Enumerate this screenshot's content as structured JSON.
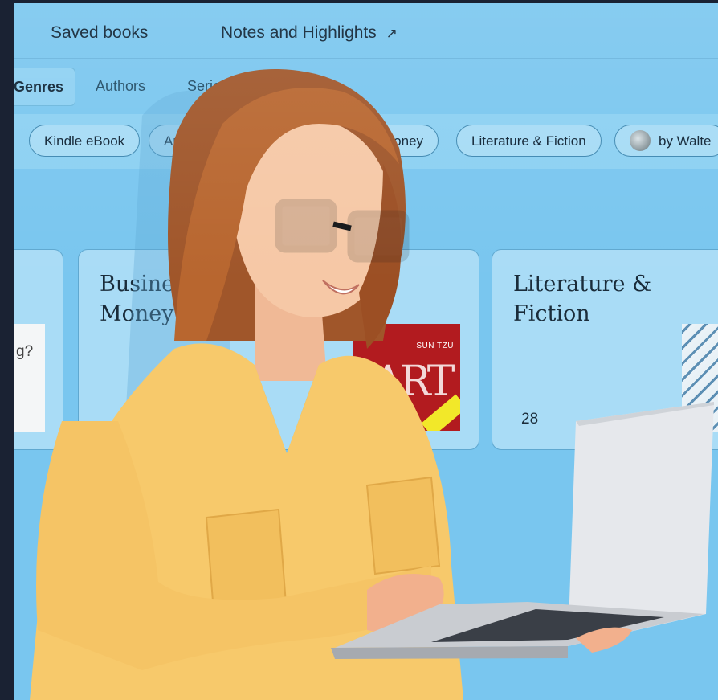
{
  "nav": {
    "saved_books": "Saved books",
    "notes_highlights": "Notes and Highlights",
    "external_icon": "arrow-up-right-icon"
  },
  "tabs": [
    {
      "label": "Genres",
      "active": true
    },
    {
      "label": "Authors",
      "active": false
    },
    {
      "label": "Series",
      "active": false
    }
  ],
  "filters": [
    {
      "label": "Kindle eBook"
    },
    {
      "label": "Audible"
    },
    {
      "label": "Money"
    },
    {
      "label": "Literature & Fiction"
    },
    {
      "label": "by Walte"
    }
  ],
  "cards": [
    {
      "title": "",
      "count": ""
    },
    {
      "title": "Busines Money",
      "count": ""
    },
    {
      "title": "Literature & Fiction",
      "count": "28"
    }
  ],
  "covers": {
    "left_partial_text": "g?",
    "art_of_war": {
      "author": "SUN TZU",
      "title": "ART"
    }
  },
  "colors": {
    "background": "#79c6ef",
    "frame": "#1a2233",
    "chip_border": "#3d87b0",
    "card": "#a9dcf6"
  }
}
